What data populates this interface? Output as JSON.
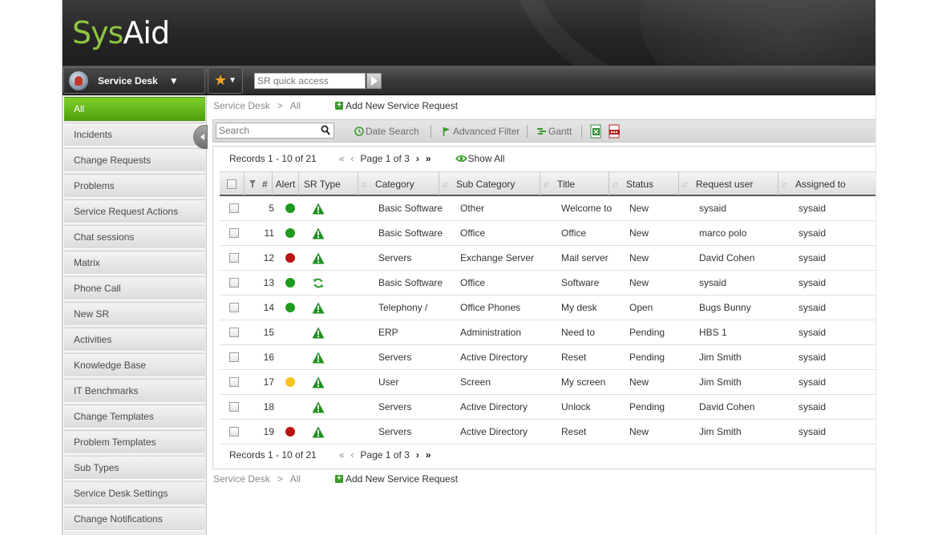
{
  "header": {
    "logo_part1": "Sys",
    "logo_part2": "A",
    "logo_part3": "id"
  },
  "navbar": {
    "module_label": "Service Desk",
    "module_caret": "▼",
    "favorites_star": "★",
    "favorites_caret": "▼",
    "quick_access_placeholder": "SR quick access"
  },
  "sidebar": {
    "items": [
      "All",
      "Incidents",
      "Change Requests",
      "Problems",
      "Service Request Actions",
      "Chat sessions",
      "Matrix",
      "Phone Call",
      "New SR",
      "Activities",
      "Knowledge Base",
      "IT Benchmarks",
      "Change Templates",
      "Problem Templates",
      "Sub Types",
      "Service Desk Settings",
      "Change Notifications"
    ],
    "active_index": 0
  },
  "breadcrumb": {
    "root": "Service Desk",
    "separator": ">",
    "current": "All",
    "add_label": "Add New Service Request"
  },
  "toolbar": {
    "search_placeholder": "Search",
    "date_search": "Date Search",
    "advanced_filter": "Advanced Filter",
    "gantt": "Gantt"
  },
  "pager": {
    "records": "Records 1 - 10 of 21",
    "first": "«",
    "prev": "‹",
    "page": "Page 1 of 3",
    "next": "›",
    "last": "»",
    "show_all": "Show All"
  },
  "table": {
    "columns": [
      "#",
      "Alert",
      "SR Type",
      "Category",
      "Sub Category",
      "Title",
      "Status",
      "Request user",
      "Assigned to"
    ],
    "rows": [
      {
        "id": "5",
        "alert": "green",
        "type": "incident",
        "category": "Basic Software",
        "sub": "Other",
        "title": "Welcome to",
        "status": "New",
        "user": "sysaid",
        "assigned": "sysaid"
      },
      {
        "id": "11",
        "alert": "green",
        "type": "incident",
        "category": "Basic Software",
        "sub": "Office",
        "title": "Office",
        "status": "New",
        "user": "marco polo",
        "assigned": "sysaid"
      },
      {
        "id": "12",
        "alert": "red",
        "type": "incident",
        "category": "Servers",
        "sub": "Exchange Server",
        "title": "Mail server",
        "status": "New",
        "user": "David Cohen",
        "assigned": "sysaid"
      },
      {
        "id": "13",
        "alert": "green",
        "type": "change",
        "category": "Basic Software",
        "sub": "Office",
        "title": "Software",
        "status": "New",
        "user": "sysaid",
        "assigned": "sysaid"
      },
      {
        "id": "14",
        "alert": "green",
        "type": "incident",
        "category": "Telephony /",
        "sub": "Office Phones",
        "title": "My desk",
        "status": "Open",
        "user": "Bugs Bunny",
        "assigned": "sysaid"
      },
      {
        "id": "15",
        "alert": "none",
        "type": "incident",
        "category": "ERP",
        "sub": "Administration",
        "title": "Need to",
        "status": "Pending",
        "user": "HBS 1",
        "assigned": "sysaid"
      },
      {
        "id": "16",
        "alert": "none",
        "type": "incident",
        "category": "Servers",
        "sub": "Active Directory",
        "title": "Reset",
        "status": "Pending",
        "user": "Jim Smith",
        "assigned": "sysaid"
      },
      {
        "id": "17",
        "alert": "yellow",
        "type": "incident",
        "category": "User",
        "sub": "Screen",
        "title": "My screen",
        "status": "New",
        "user": "Jim Smith",
        "assigned": "sysaid"
      },
      {
        "id": "18",
        "alert": "none",
        "type": "incident",
        "category": "Servers",
        "sub": "Active Directory",
        "title": "Unlock",
        "status": "Pending",
        "user": "David Cohen",
        "assigned": "sysaid"
      },
      {
        "id": "19",
        "alert": "red",
        "type": "incident",
        "category": "Servers",
        "sub": "Active Directory",
        "title": "Reset",
        "status": "New",
        "user": "Jim Smith",
        "assigned": "sysaid"
      }
    ]
  },
  "colors": {
    "brand_green": "#8dc63f",
    "active_nav": "#5fb21a",
    "alert_green": "#1e9b1e",
    "alert_red": "#b81414",
    "alert_yellow": "#f5c21b"
  }
}
